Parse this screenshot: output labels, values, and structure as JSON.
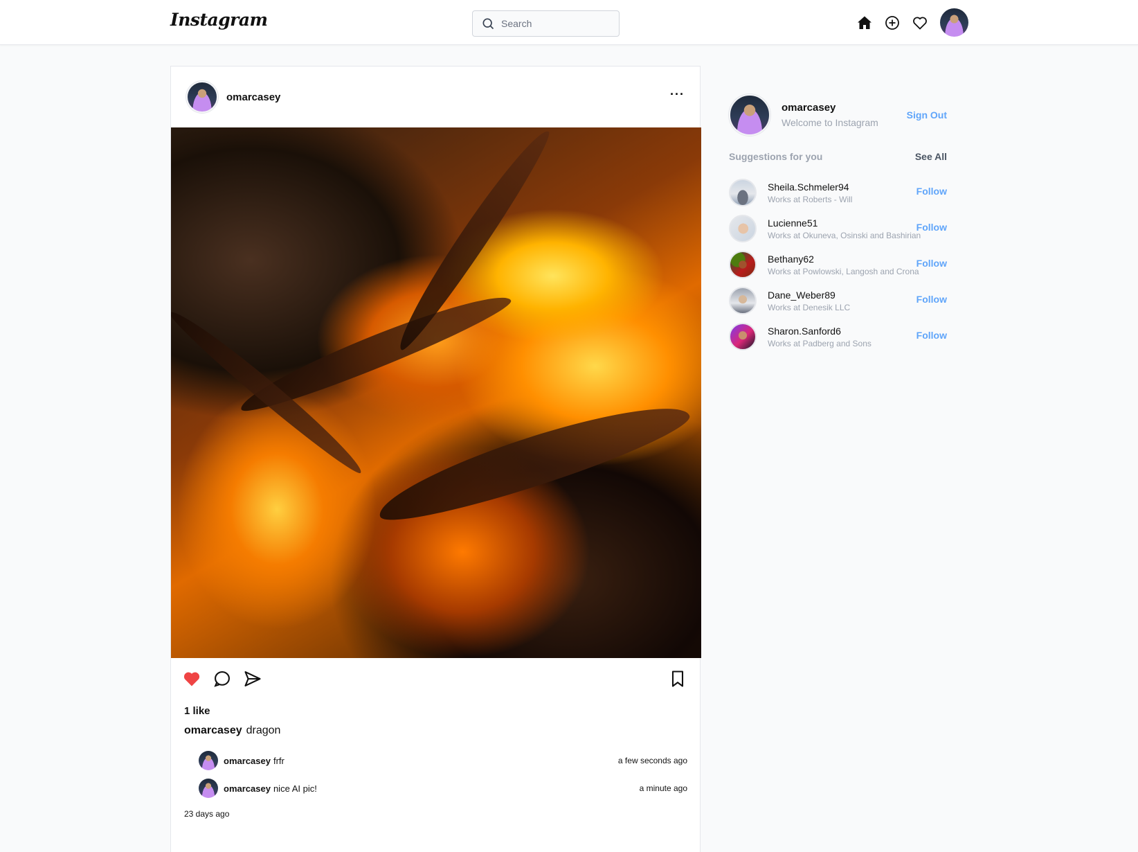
{
  "header": {
    "logo": "Instagram",
    "search_placeholder": "Search",
    "icons": [
      "home-icon",
      "add-post-icon",
      "heart-icon"
    ]
  },
  "post": {
    "username": "omarcasey",
    "more_label": "···",
    "image_alt": "dragon",
    "liked": true,
    "likes_text": "1 like",
    "caption_user": "omarcasey",
    "caption_text": "dragon",
    "comments": [
      {
        "user": "omarcasey",
        "text": "frfr",
        "time": "a few seconds ago"
      },
      {
        "user": "omarcasey",
        "text": "nice AI pic!",
        "time": "a minute ago"
      }
    ],
    "date": "23 days ago",
    "colors": {
      "like": "#ef4444"
    }
  },
  "sidebar": {
    "me": {
      "username": "omarcasey",
      "subtitle": "Welcome to Instagram",
      "signout_label": "Sign Out"
    },
    "suggestions_title": "Suggestions for you",
    "see_all_label": "See All",
    "suggestions": [
      {
        "username": "Sheila.Schmeler94",
        "work": "Works at Roberts - Will",
        "follow": "Follow"
      },
      {
        "username": "Lucienne51",
        "work": "Works at Okuneva, Osinski and Bashirian",
        "follow": "Follow"
      },
      {
        "username": "Bethany62",
        "work": "Works at Powlowski, Langosh and Crona",
        "follow": "Follow"
      },
      {
        "username": "Dane_Weber89",
        "work": "Works at Denesik LLC",
        "follow": "Follow"
      },
      {
        "username": "Sharon.Sanford6",
        "work": "Works at Padberg and Sons",
        "follow": "Follow"
      }
    ],
    "colors": {
      "accent": "#60a5fa",
      "muted": "#9ca3af"
    }
  }
}
